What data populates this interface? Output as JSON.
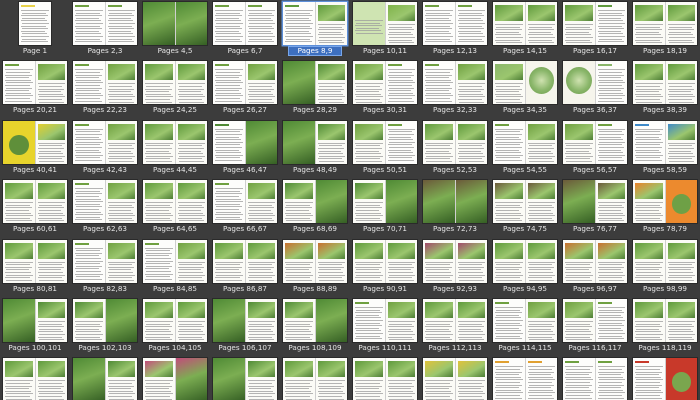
{
  "viewer": {
    "selected_label": "Pages 8,9",
    "pages": [
      {
        "label": "Page 1",
        "kind": "single",
        "styles": [
          "text"
        ],
        "accent": "#e8d24a"
      },
      {
        "label": "Pages 2,3",
        "kind": "spread",
        "styles": [
          "text",
          "text"
        ],
        "accent": "#6fa040"
      },
      {
        "label": "Pages 4,5",
        "kind": "spread",
        "styles": [
          "photo",
          "photo"
        ],
        "accent": "#4f8a35"
      },
      {
        "label": "Pages 6,7",
        "kind": "spread",
        "styles": [
          "text",
          "text"
        ],
        "accent": "#6fa040"
      },
      {
        "label": "Pages 8,9",
        "kind": "spread",
        "styles": [
          "text",
          "mixed"
        ],
        "accent": "#5f9a3c"
      },
      {
        "label": "Pages 10,11",
        "kind": "spread",
        "styles": [
          "green",
          "mixed"
        ],
        "accent": "#7fb34a"
      },
      {
        "label": "Pages 12,13",
        "kind": "spread",
        "styles": [
          "text",
          "text"
        ],
        "accent": "#6fa040"
      },
      {
        "label": "Pages 14,15",
        "kind": "spread",
        "styles": [
          "mixed",
          "mixed"
        ],
        "accent": "#5f9a3c"
      },
      {
        "label": "Pages 16,17",
        "kind": "spread",
        "styles": [
          "mixed",
          "text"
        ],
        "accent": "#5f9a3c"
      },
      {
        "label": "Pages 18,19",
        "kind": "spread",
        "styles": [
          "mixed",
          "mixed"
        ],
        "accent": "#5f9a3c"
      },
      {
        "label": "Pages 20,21",
        "kind": "spread",
        "styles": [
          "text",
          "mixed"
        ],
        "accent": "#6fa040"
      },
      {
        "label": "Pages 22,23",
        "kind": "spread",
        "styles": [
          "text",
          "mixed"
        ],
        "accent": "#6fa040"
      },
      {
        "label": "Pages 24,25",
        "kind": "spread",
        "styles": [
          "mixed",
          "mixed"
        ],
        "accent": "#5f9a3c"
      },
      {
        "label": "Pages 26,27",
        "kind": "spread",
        "styles": [
          "text",
          "mixed"
        ],
        "accent": "#6fa040"
      },
      {
        "label": "Pages 28,29",
        "kind": "spread",
        "styles": [
          "photo",
          "mixed"
        ],
        "accent": "#4f8a35"
      },
      {
        "label": "Pages 30,31",
        "kind": "spread",
        "styles": [
          "mixed",
          "text"
        ],
        "accent": "#6fa040"
      },
      {
        "label": "Pages 32,33",
        "kind": "spread",
        "styles": [
          "text",
          "mixed"
        ],
        "accent": "#6fa040"
      },
      {
        "label": "Pages 34,35",
        "kind": "spread",
        "styles": [
          "mixed",
          "plan"
        ],
        "accent": "#8ab66a"
      },
      {
        "label": "Pages 36,37",
        "kind": "spread",
        "styles": [
          "plan",
          "text"
        ],
        "accent": "#8ab66a"
      },
      {
        "label": "Pages 38,39",
        "kind": "spread",
        "styles": [
          "mixed",
          "mixed"
        ],
        "accent": "#5f9a3c"
      },
      {
        "label": "Pages 40,41",
        "kind": "spread",
        "styles": [
          "yellow",
          "mixed"
        ],
        "accent": "#e2cf2e"
      },
      {
        "label": "Pages 42,43",
        "kind": "spread",
        "styles": [
          "text",
          "mixed"
        ],
        "accent": "#6fa040"
      },
      {
        "label": "Pages 44,45",
        "kind": "spread",
        "styles": [
          "mixed",
          "mixed"
        ],
        "accent": "#5f9a3c"
      },
      {
        "label": "Pages 46,47",
        "kind": "spread",
        "styles": [
          "text",
          "photo"
        ],
        "accent": "#4f8a35"
      },
      {
        "label": "Pages 48,49",
        "kind": "spread",
        "styles": [
          "photo",
          "mixed"
        ],
        "accent": "#4f8a35"
      },
      {
        "label": "Pages 50,51",
        "kind": "spread",
        "styles": [
          "mixed",
          "text"
        ],
        "accent": "#6fa040"
      },
      {
        "label": "Pages 52,53",
        "kind": "spread",
        "styles": [
          "mixed",
          "mixed"
        ],
        "accent": "#5f9a3c"
      },
      {
        "label": "Pages 54,55",
        "kind": "spread",
        "styles": [
          "text",
          "mixed"
        ],
        "accent": "#6fa040"
      },
      {
        "label": "Pages 56,57",
        "kind": "spread",
        "styles": [
          "mixed",
          "text"
        ],
        "accent": "#6fa040"
      },
      {
        "label": "Pages 58,59",
        "kind": "spread",
        "styles": [
          "text",
          "mixed"
        ],
        "accent": "#3f8ac8"
      },
      {
        "label": "Pages 60,61",
        "kind": "spread",
        "styles": [
          "mixed",
          "mixed"
        ],
        "accent": "#5f9a3c"
      },
      {
        "label": "Pages 62,63",
        "kind": "spread",
        "styles": [
          "text",
          "mixed"
        ],
        "accent": "#6fa040"
      },
      {
        "label": "Pages 64,65",
        "kind": "spread",
        "styles": [
          "mixed",
          "mixed"
        ],
        "accent": "#5f9a3c"
      },
      {
        "label": "Pages 66,67",
        "kind": "spread",
        "styles": [
          "text",
          "mixed"
        ],
        "accent": "#6fa040"
      },
      {
        "label": "Pages 68,69",
        "kind": "spread",
        "styles": [
          "mixed",
          "photo"
        ],
        "accent": "#4f8a35"
      },
      {
        "label": "Pages 70,71",
        "kind": "spread",
        "styles": [
          "mixed",
          "photo"
        ],
        "accent": "#4f8a35"
      },
      {
        "label": "Pages 72,73",
        "kind": "spread",
        "styles": [
          "photo",
          "photo"
        ],
        "accent": "#6b5a3a"
      },
      {
        "label": "Pages 74,75",
        "kind": "spread",
        "styles": [
          "mixed",
          "mixed"
        ],
        "accent": "#6b5a3a"
      },
      {
        "label": "Pages 76,77",
        "kind": "spread",
        "styles": [
          "photo",
          "mixed"
        ],
        "accent": "#6b5a3a"
      },
      {
        "label": "Pages 78,79",
        "kind": "spread",
        "styles": [
          "mixed",
          "orange"
        ],
        "accent": "#e9822a"
      },
      {
        "label": "Pages 80,81",
        "kind": "spread",
        "styles": [
          "mixed",
          "mixed"
        ],
        "accent": "#5f9a3c"
      },
      {
        "label": "Pages 82,83",
        "kind": "spread",
        "styles": [
          "text",
          "mixed"
        ],
        "accent": "#6fa040"
      },
      {
        "label": "Pages 84,85",
        "kind": "spread",
        "styles": [
          "text",
          "mixed"
        ],
        "accent": "#6fa040"
      },
      {
        "label": "Pages 86,87",
        "kind": "spread",
        "styles": [
          "mixed",
          "mixed"
        ],
        "accent": "#5f9a3c"
      },
      {
        "label": "Pages 88,89",
        "kind": "spread",
        "styles": [
          "mixed",
          "mixed"
        ],
        "accent": "#c9702e"
      },
      {
        "label": "Pages 90,91",
        "kind": "spread",
        "styles": [
          "mixed",
          "mixed"
        ],
        "accent": "#5f9a3c"
      },
      {
        "label": "Pages 92,93",
        "kind": "spread",
        "styles": [
          "mixed",
          "mixed"
        ],
        "accent": "#a24a6a"
      },
      {
        "label": "Pages 94,95",
        "kind": "spread",
        "styles": [
          "mixed",
          "mixed"
        ],
        "accent": "#5f9a3c"
      },
      {
        "label": "Pages 96,97",
        "kind": "spread",
        "styles": [
          "mixed",
          "mixed"
        ],
        "accent": "#c9702e"
      },
      {
        "label": "Pages 98,99",
        "kind": "spread",
        "styles": [
          "mixed",
          "mixed"
        ],
        "accent": "#5f9a3c"
      },
      {
        "label": "Pages 100,101",
        "kind": "spread",
        "styles": [
          "photo",
          "mixed"
        ],
        "accent": "#4f8a35"
      },
      {
        "label": "Pages 102,103",
        "kind": "spread",
        "styles": [
          "mixed",
          "photo"
        ],
        "accent": "#4f8a35"
      },
      {
        "label": "Pages 104,105",
        "kind": "spread",
        "styles": [
          "mixed",
          "mixed"
        ],
        "accent": "#5f9a3c"
      },
      {
        "label": "Pages 106,107",
        "kind": "spread",
        "styles": [
          "photo",
          "mixed"
        ],
        "accent": "#4f8a35"
      },
      {
        "label": "Pages 108,109",
        "kind": "spread",
        "styles": [
          "mixed",
          "photo"
        ],
        "accent": "#4f8a35"
      },
      {
        "label": "Pages 110,111",
        "kind": "spread",
        "styles": [
          "text",
          "mixed"
        ],
        "accent": "#6fa040"
      },
      {
        "label": "Pages 112,113",
        "kind": "spread",
        "styles": [
          "mixed",
          "mixed"
        ],
        "accent": "#5f9a3c"
      },
      {
        "label": "Pages 114,115",
        "kind": "spread",
        "styles": [
          "text",
          "mixed"
        ],
        "accent": "#6fa040"
      },
      {
        "label": "Pages 116,117",
        "kind": "spread",
        "styles": [
          "mixed",
          "text"
        ],
        "accent": "#6fa040"
      },
      {
        "label": "Pages 118,119",
        "kind": "spread",
        "styles": [
          "mixed",
          "mixed"
        ],
        "accent": "#5f9a3c"
      },
      {
        "label": "",
        "kind": "spread",
        "styles": [
          "mixed",
          "mixed"
        ],
        "accent": "#5f9a3c"
      },
      {
        "label": "",
        "kind": "spread",
        "styles": [
          "photo",
          "mixed"
        ],
        "accent": "#4f8a35"
      },
      {
        "label": "",
        "kind": "spread",
        "styles": [
          "mixed",
          "photo"
        ],
        "accent": "#c24c7a"
      },
      {
        "label": "",
        "kind": "spread",
        "styles": [
          "photo",
          "mixed"
        ],
        "accent": "#4f8a35"
      },
      {
        "label": "",
        "kind": "spread",
        "styles": [
          "mixed",
          "mixed"
        ],
        "accent": "#5f9a3c"
      },
      {
        "label": "",
        "kind": "spread",
        "styles": [
          "mixed",
          "mixed"
        ],
        "accent": "#5f9a3c"
      },
      {
        "label": "",
        "kind": "spread",
        "styles": [
          "mixed",
          "mixed"
        ],
        "accent": "#e0c23a"
      },
      {
        "label": "",
        "kind": "spread",
        "styles": [
          "text",
          "text"
        ],
        "accent": "#e0a030"
      },
      {
        "label": "",
        "kind": "spread",
        "styles": [
          "text",
          "text"
        ],
        "accent": "#6fa040"
      },
      {
        "label": "",
        "kind": "spread",
        "styles": [
          "text",
          "red"
        ],
        "accent": "#c83a2a"
      }
    ]
  }
}
